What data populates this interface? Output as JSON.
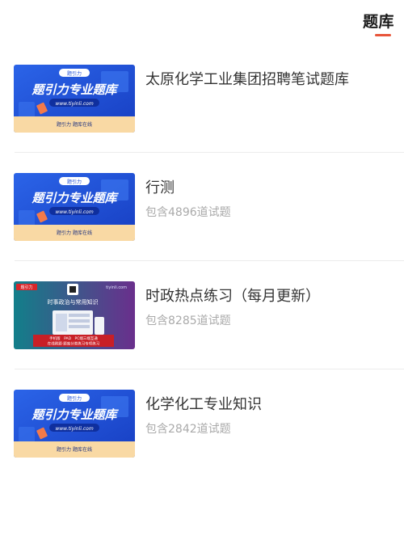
{
  "header": {
    "tab_label": "题库"
  },
  "colors": {
    "accent": "#e8553a",
    "banner_blue": "#1f4fd6",
    "banner_purple": "#6a2f8c",
    "banner_teal": "#127f8a"
  },
  "items": [
    {
      "title": "太原化学工业集团招聘笔试题库",
      "subtitle": "",
      "thumb": {
        "style": "blue",
        "logo": "题引力",
        "heading": "题引力专业题库",
        "url": "www.tiyinli.com",
        "footer": "题引力 题库在线"
      }
    },
    {
      "title": "行测",
      "subtitle": "包含4896道试题",
      "thumb": {
        "style": "blue",
        "logo": "题引力",
        "heading": "题引力专业题库",
        "url": "www.tiyinli.com",
        "footer": "题引力 题库在线"
      }
    },
    {
      "title": "时政热点练习（每月更新）",
      "subtitle": "包含8285道试题",
      "thumb": {
        "style": "purple",
        "tag": "题引力",
        "heading": "时事政治与常用知识",
        "url": "tiyinli.com",
        "footer1": "手机版　PAD　PC端三端互通",
        "footer2": "在线刷题·题库分类练习专项练习"
      }
    },
    {
      "title": "化学化工专业知识",
      "subtitle": "包含2842道试题",
      "thumb": {
        "style": "blue",
        "logo": "题引力",
        "heading": "题引力专业题库",
        "url": "www.tiyinli.com",
        "footer": "题引力 题库在线"
      }
    }
  ]
}
